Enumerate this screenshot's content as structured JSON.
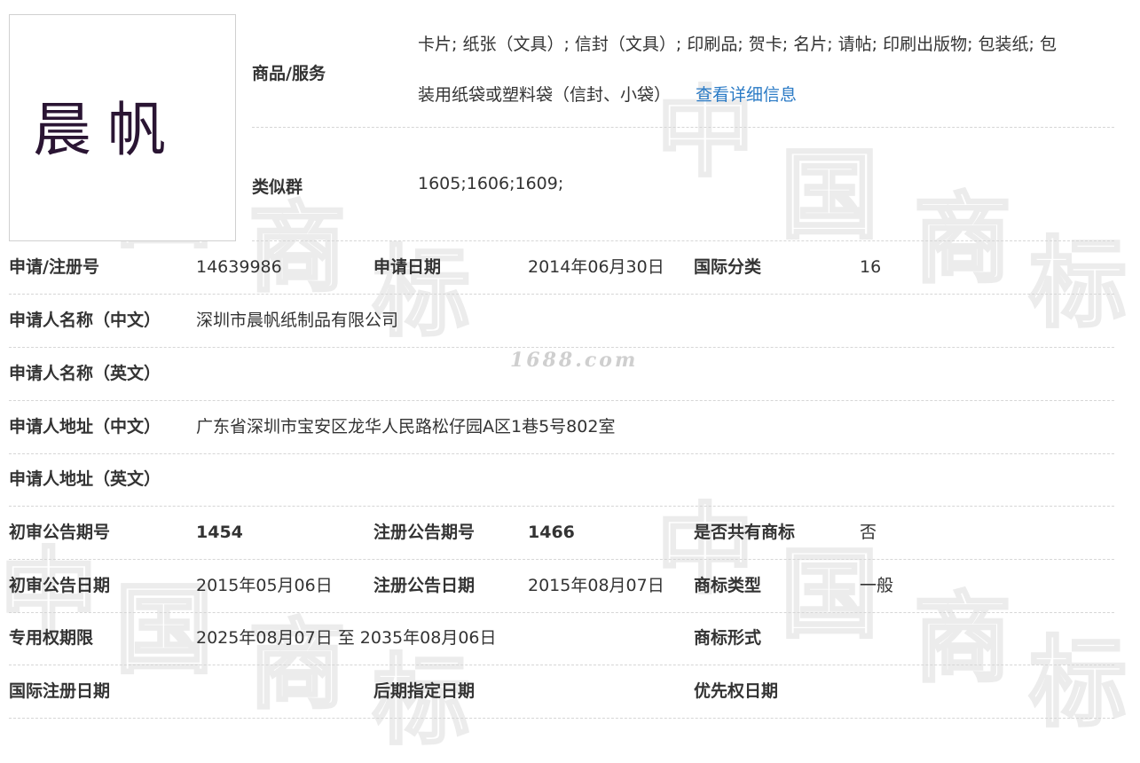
{
  "watermark": {
    "glyphs": [
      "中",
      "国",
      "商",
      "标"
    ],
    "site": "1688.com"
  },
  "logo": {
    "text": "晨帆"
  },
  "goods": {
    "label": "商品/服务",
    "line1": "卡片; 纸张（文具）; 信封（文具）; 印刷品; 贺卡; 名片; 请帖; 印刷出版物; 包装纸; 包",
    "line2": "装用纸袋或塑料袋（信封、小袋）",
    "link": "查看详细信息"
  },
  "similar_group": {
    "label": "类似群",
    "value": "1605;1606;1609;"
  },
  "rows": {
    "r1": {
      "l1": "申请/注册号",
      "v1": "14639986",
      "l2": "申请日期",
      "v2": "2014年06月30日",
      "l3": "国际分类",
      "v3": "16"
    },
    "r2": {
      "l1": "申请人名称（中文）",
      "v1": "深圳市晨帆纸制品有限公司"
    },
    "r3": {
      "l1": "申请人名称（英文）",
      "v1": ""
    },
    "r4": {
      "l1": "申请人地址（中文）",
      "v1": "广东省深圳市宝安区龙华人民路松仔园A区1巷5号802室"
    },
    "r5": {
      "l1": "申请人地址（英文）",
      "v1": ""
    },
    "r6": {
      "l1": "初审公告期号",
      "v1": "1454",
      "l2": "注册公告期号",
      "v2": "1466",
      "l3": "是否共有商标",
      "v3": "否"
    },
    "r7": {
      "l1": "初审公告日期",
      "v1": "2015年05月06日",
      "l2": "注册公告日期",
      "v2": "2015年08月07日",
      "l3": "商标类型",
      "v3": "一般"
    },
    "r8": {
      "l1": "专用权期限",
      "v1": "2025年08月07日 至 2035年08月06日",
      "l3": "商标形式",
      "v3": ""
    },
    "r9": {
      "l1": "国际注册日期",
      "v1": "",
      "l2": "后期指定日期",
      "v2": "",
      "l3": "优先权日期",
      "v3": ""
    }
  }
}
